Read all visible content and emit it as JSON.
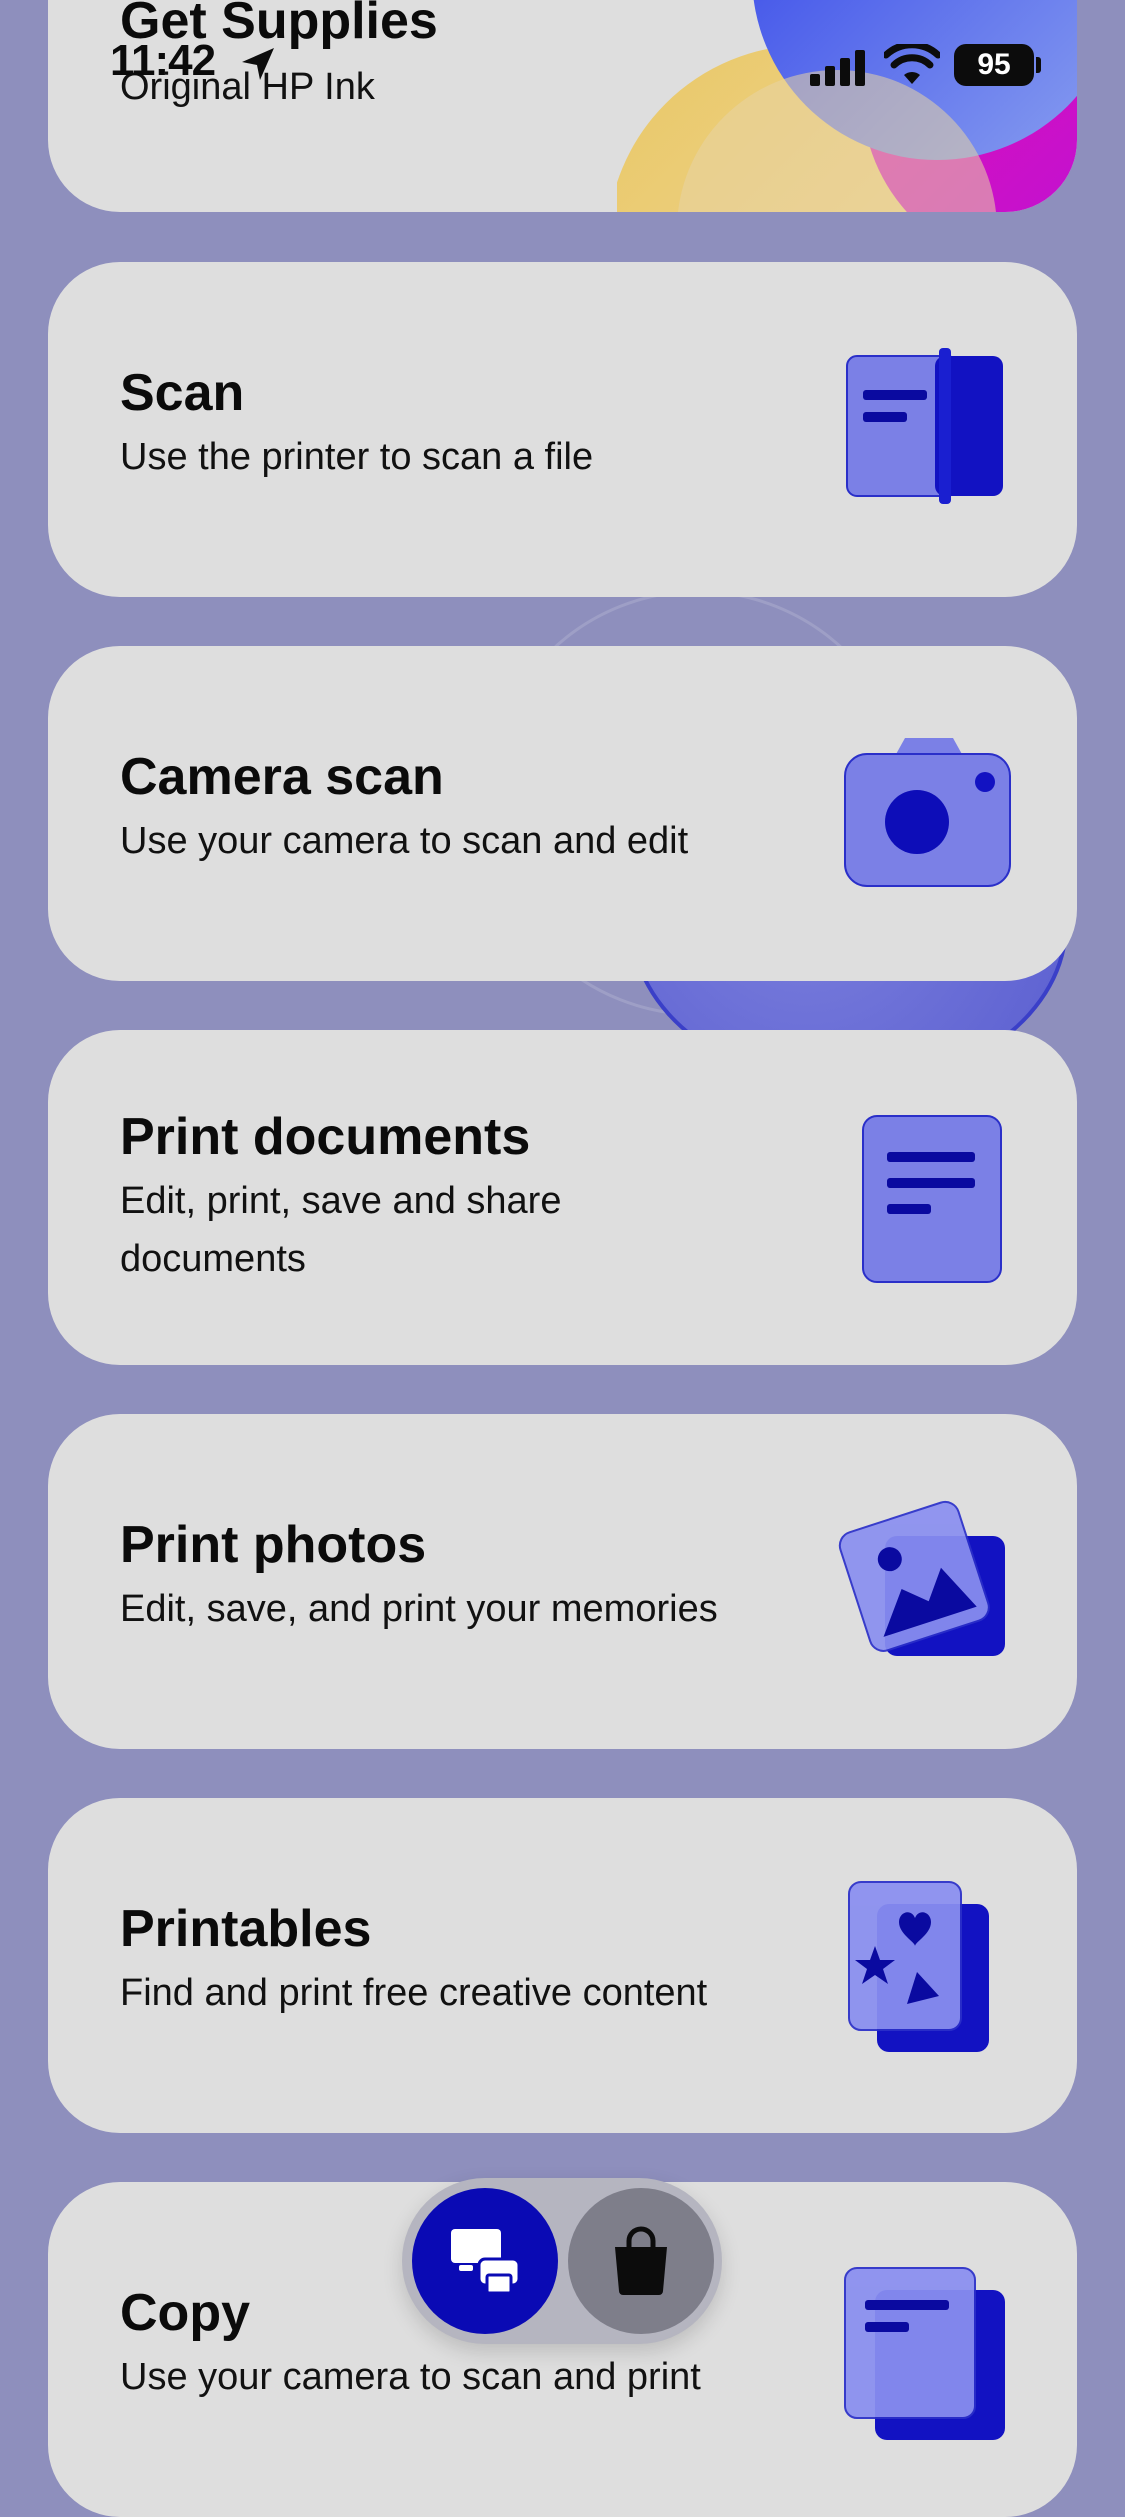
{
  "status_bar": {
    "time": "11:42",
    "battery": "95"
  },
  "supplies_card": {
    "title": "Get Supplies",
    "subtitle": "Original HP Ink"
  },
  "cards": [
    {
      "id": "scan",
      "title": "Scan",
      "subtitle": "Use the printer to scan a file",
      "icon": "scanner-icon"
    },
    {
      "id": "camera-scan",
      "title": "Camera scan",
      "subtitle": "Use your camera to scan and edit",
      "icon": "camera-icon"
    },
    {
      "id": "print-documents",
      "title": "Print documents",
      "subtitle": "Edit, print, save and share documents",
      "icon": "document-icon"
    },
    {
      "id": "print-photos",
      "title": "Print photos",
      "subtitle": "Edit, save, and print your memories",
      "icon": "photo-icon"
    },
    {
      "id": "printables",
      "title": "Printables",
      "subtitle": "Find and print free creative content",
      "icon": "printables-icon"
    },
    {
      "id": "copy",
      "title": "Copy",
      "subtitle": "Use your camera to scan and print",
      "icon": "copy-icon"
    }
  ],
  "tab_bar": {
    "items": [
      {
        "name": "printer-tab",
        "icon": "printer-icon",
        "active": true
      },
      {
        "name": "shop-tab",
        "icon": "shopping-bag-icon",
        "active": false
      }
    ]
  },
  "colors": {
    "background": "#8e8fbd",
    "card": "#dedede",
    "accent": "#0a0ab4",
    "icon_light": "#7b80e6"
  }
}
